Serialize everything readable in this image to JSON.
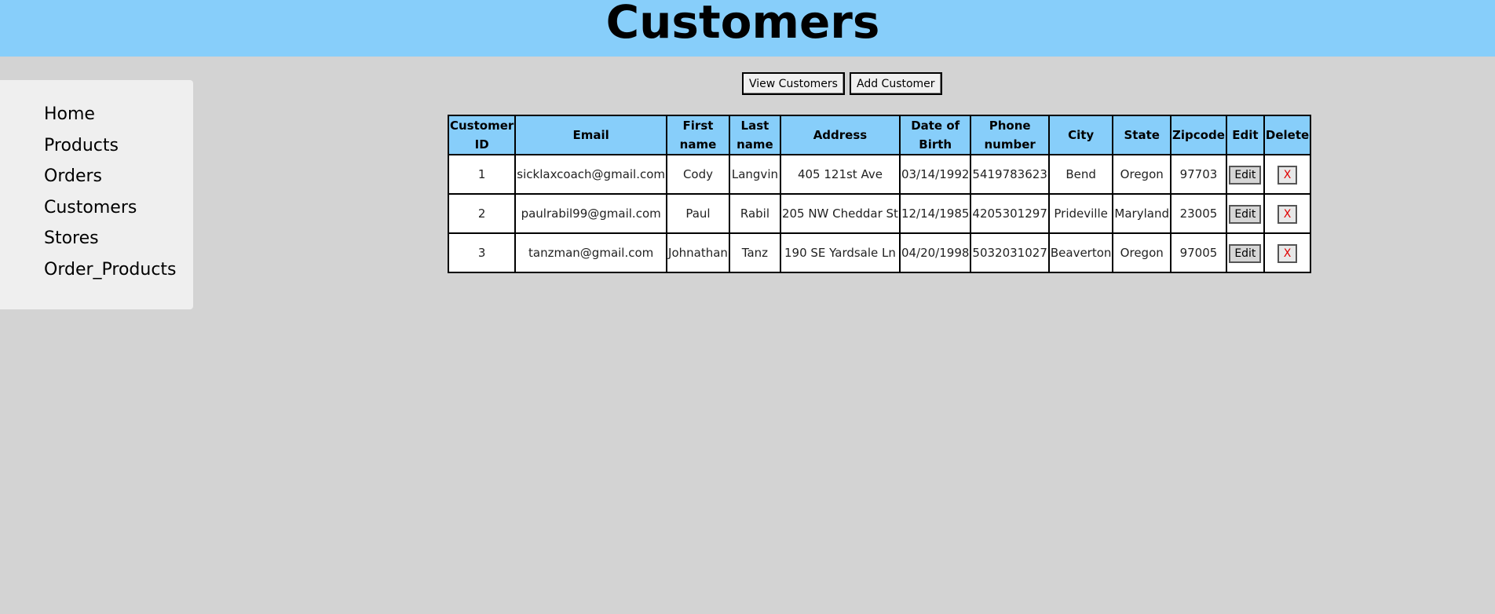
{
  "header": {
    "title": "Customers"
  },
  "sidebar": {
    "items": [
      {
        "label": "Home"
      },
      {
        "label": "Products"
      },
      {
        "label": "Orders"
      },
      {
        "label": "Customers"
      },
      {
        "label": "Stores"
      },
      {
        "label": "Order_Products"
      }
    ]
  },
  "actions": {
    "view_label": "View Customers",
    "add_label": "Add Customer"
  },
  "table": {
    "headers": [
      "Customer ID",
      "Email",
      "First name",
      "Last name",
      "Address",
      "Date of Birth",
      "Phone number",
      "City",
      "State",
      "Zipcode",
      "Edit",
      "Delete"
    ],
    "rows": [
      {
        "id": "1",
        "email": "sicklaxcoach@gmail.com",
        "first": "Cody",
        "last": "Langvin",
        "address": "405 121st Ave",
        "dob": "03/14/1992",
        "phone": "5419783623",
        "city": "Bend",
        "state": "Oregon",
        "zip": "97703",
        "edit": "Edit",
        "delete": "X"
      },
      {
        "id": "2",
        "email": "paulrabil99@gmail.com",
        "first": "Paul",
        "last": "Rabil",
        "address": "205 NW Cheddar St",
        "dob": "12/14/1985",
        "phone": "4205301297",
        "city": "Prideville",
        "state": "Maryland",
        "zip": "23005",
        "edit": "Edit",
        "delete": "X"
      },
      {
        "id": "3",
        "email": "tanzman@gmail.com",
        "first": "Johnathan",
        "last": "Tanz",
        "address": "190 SE Yardsale Ln",
        "dob": "04/20/1998",
        "phone": "5032031027",
        "city": "Beaverton",
        "state": "Oregon",
        "zip": "97005",
        "edit": "Edit",
        "delete": "X"
      }
    ]
  },
  "colors": {
    "header_bg": "#87cefa",
    "page_bg": "#d3d3d3",
    "sidebar_bg": "#efefef",
    "delete_text": "#e00000"
  }
}
